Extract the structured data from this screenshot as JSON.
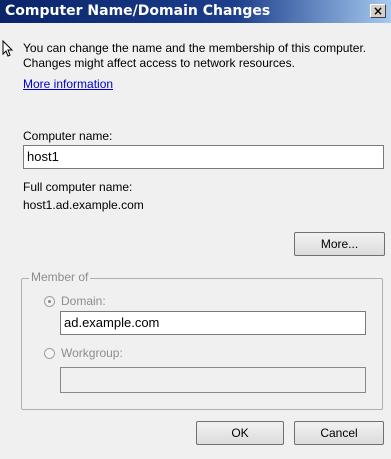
{
  "window": {
    "title": "Computer Name/Domain Changes",
    "close_glyph": "×"
  },
  "intro": {
    "text": "You can change the name and the membership of this computer. Changes might affect access to network resources.",
    "link": "More information"
  },
  "computer_name": {
    "label": "Computer name:",
    "value": "host1"
  },
  "full_name": {
    "label": "Full computer name:",
    "value": "host1.ad.example.com"
  },
  "more_button": "More...",
  "member_of": {
    "legend": "Member of",
    "domain_label": "Domain:",
    "domain_value": "ad.example.com",
    "workgroup_label": "Workgroup:",
    "workgroup_value": ""
  },
  "buttons": {
    "ok": "OK",
    "cancel": "Cancel"
  }
}
